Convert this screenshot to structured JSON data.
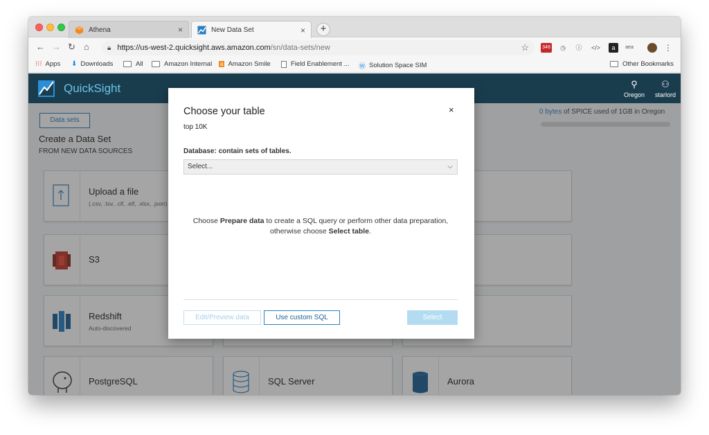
{
  "browser": {
    "tabs": [
      {
        "label": "Athena",
        "favicon": "athena-orange-cube-icon"
      },
      {
        "label": "New Data Set",
        "favicon": "quicksight-icon"
      }
    ],
    "url_host": "https://us-west-2.quicksight.aws.amazon.com",
    "url_path": "/sn/data-sets/new",
    "extensions": [
      "348",
      "aea"
    ],
    "bookmarks": [
      {
        "label": "Apps"
      },
      {
        "label": "Downloads"
      },
      {
        "label": "All"
      },
      {
        "label": "Amazon Internal"
      },
      {
        "label": "Amazon Smile"
      },
      {
        "label": "Field Enablement ..."
      },
      {
        "label": "Solution Space SIM"
      },
      {
        "label": "Other Bookmarks"
      }
    ]
  },
  "app": {
    "title": "QuickSight",
    "region": "Oregon",
    "user": "starlord",
    "datasets_button": "Data sets",
    "spice_used": "0 bytes",
    "spice_text": " of SPICE used of 1GB in Oregon",
    "section_title": "Create a Data Set",
    "section_sub": "FROM NEW DATA SOURCES",
    "sources": [
      {
        "name": "Upload a file",
        "desc": "(.csv, .tsv, .clf, .elf, .xlsx, .json)"
      },
      {
        "name": "S3",
        "desc": ""
      },
      {
        "name": "Redshift",
        "desc": "Auto-discovered"
      },
      {
        "name": "PostgreSQL",
        "desc": ""
      },
      {
        "name": "SQL Server",
        "desc": ""
      },
      {
        "name": "Aurora",
        "desc": ""
      }
    ]
  },
  "modal": {
    "title": "Choose your table",
    "subtitle": "top 10K",
    "close": "×",
    "database_label": "Database: contain sets of tables.",
    "database_placeholder": "Select...",
    "help_1": "Choose ",
    "help_bold_1": "Prepare data",
    "help_2": " to create a SQL query or perform other data preparation,",
    "help_3": "otherwise choose ",
    "help_bold_2": "Select table",
    "help_4": ".",
    "btn_preview": "Edit/Preview data",
    "btn_sql": "Use custom SQL",
    "btn_select": "Select"
  },
  "colors": {
    "header_bg": "#1a3d4e",
    "brand": "#68c3e8",
    "link_blue": "#2a7fc1",
    "select_disabled": "#b3dcf3"
  }
}
